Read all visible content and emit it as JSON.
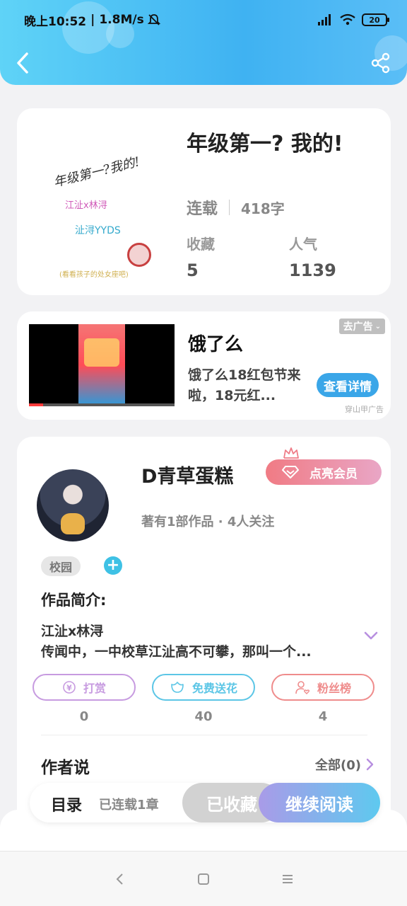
{
  "status_bar": {
    "time": "晚上10:52",
    "speed": "1.8M/s",
    "battery": "20"
  },
  "book": {
    "cover": {
      "title": "年级第一?我的!",
      "line1": "江沚x林浔",
      "line2": "沚浔YYDS",
      "line3": "(看看孩子的处女座吧)"
    },
    "title": "年级第一? 我的!",
    "status": "连载",
    "word_count": "418字",
    "favorites_label": "收藏",
    "favorites_value": "5",
    "popularity_label": "人气",
    "popularity_value": "1139"
  },
  "ad": {
    "title": "饿了么",
    "description": "饿了么18红包节来啦，18元红...",
    "close_label": "去广告",
    "button_label": "查看详情",
    "source": "穿山甲广告"
  },
  "author": {
    "name": "D青草蛋糕",
    "vip_label": "点亮会员",
    "subtitle": "著有1部作品 · 4人关注",
    "tag": "校园",
    "tag_add": "+",
    "intro_heading": "作品简介:",
    "intro_line1": "江沚x林浔",
    "intro_line2": "传闻中，一中校草江沚高不可攀，那叫一个...",
    "actions": [
      {
        "label": "打赏",
        "value": "0",
        "color": "#c79be0"
      },
      {
        "label": "免费送花",
        "value": "40",
        "color": "#5cc6e6"
      },
      {
        "label": "粉丝榜",
        "value": "4",
        "color": "#ef8c8c"
      }
    ],
    "says_heading": "作者说",
    "says_all": "全部(0)"
  },
  "bottom_bar": {
    "toc_label": "目录",
    "serial_status": "已连载1章",
    "collected_label": "已收藏",
    "read_label": "继续阅读"
  }
}
